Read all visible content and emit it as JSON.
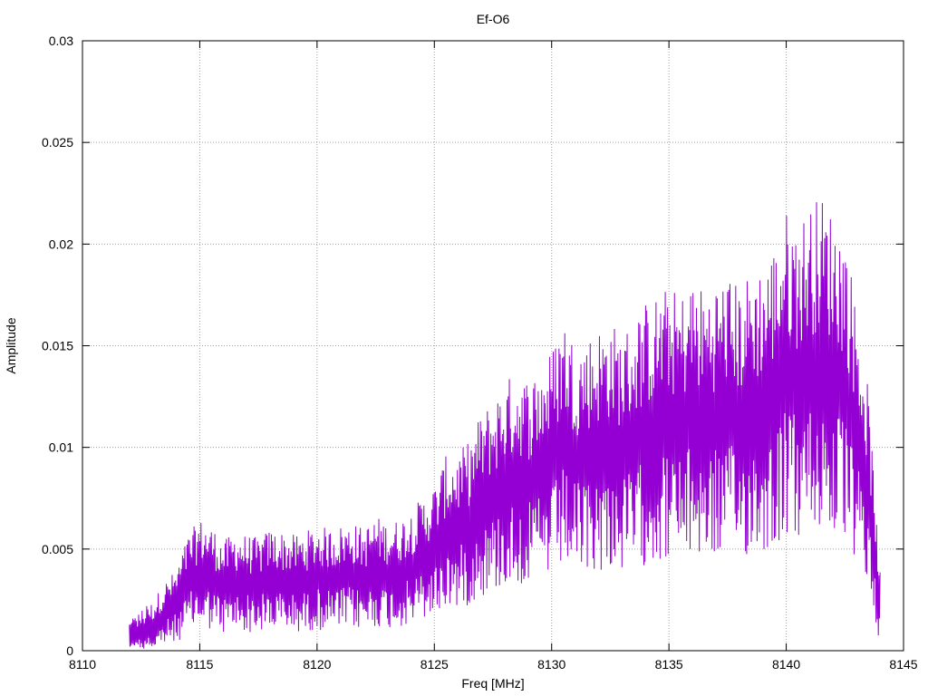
{
  "chart_data": {
    "type": "line",
    "title": "Ef-O6",
    "xlabel": "Freq [MHz]",
    "ylabel": "Amplitude",
    "xlim": [
      8110,
      8145
    ],
    "ylim": [
      0,
      0.03
    ],
    "xticks": [
      8110,
      8115,
      8120,
      8125,
      8130,
      8135,
      8140,
      8145
    ],
    "xtick_labels": [
      "8110",
      "8115",
      "8120",
      "8125",
      "8130",
      "8135",
      "8140",
      "8145"
    ],
    "yticks": [
      0,
      0.005,
      0.01,
      0.015,
      0.02,
      0.025,
      0.03
    ],
    "ytick_labels": [
      "0",
      "0.005",
      "0.01",
      "0.015",
      "0.02",
      "0.025",
      "0.03"
    ],
    "grid": true,
    "line_color": "#9400d3",
    "series": [
      {
        "name": "",
        "x": [
          8112.0,
          8112.5,
          8113.0,
          8113.5,
          8114.0,
          8114.5,
          8115.0,
          8115.5,
          8116.0,
          8116.5,
          8117.0,
          8117.5,
          8118.0,
          8118.5,
          8119.0,
          8119.5,
          8120.0,
          8120.5,
          8121.0,
          8121.5,
          8122.0,
          8122.5,
          8123.0,
          8123.5,
          8124.0,
          8124.5,
          8125.0,
          8125.5,
          8126.0,
          8126.5,
          8127.0,
          8127.5,
          8128.0,
          8128.5,
          8129.0,
          8129.5,
          8130.0,
          8130.5,
          8131.0,
          8131.5,
          8132.0,
          8132.5,
          8133.0,
          8133.5,
          8134.0,
          8134.5,
          8135.0,
          8135.5,
          8136.0,
          8136.5,
          8137.0,
          8137.5,
          8138.0,
          8138.5,
          8139.0,
          8139.5,
          8140.0,
          8140.5,
          8141.0,
          8141.5,
          8142.0,
          8142.5,
          8143.0,
          8143.5,
          8144.0
        ],
        "y": [
          0.0006,
          0.0009,
          0.0012,
          0.0018,
          0.0022,
          0.0033,
          0.0038,
          0.0036,
          0.0031,
          0.0034,
          0.0033,
          0.0032,
          0.0035,
          0.0034,
          0.0033,
          0.0034,
          0.0036,
          0.0035,
          0.0036,
          0.0037,
          0.0035,
          0.0039,
          0.0037,
          0.0038,
          0.0041,
          0.0045,
          0.0049,
          0.0058,
          0.0059,
          0.0063,
          0.0072,
          0.0076,
          0.0082,
          0.0085,
          0.0083,
          0.0087,
          0.0092,
          0.0103,
          0.0094,
          0.0096,
          0.0099,
          0.0101,
          0.0097,
          0.0102,
          0.0107,
          0.0109,
          0.0112,
          0.0109,
          0.0115,
          0.0111,
          0.0114,
          0.0116,
          0.0112,
          0.0117,
          0.0119,
          0.0125,
          0.0136,
          0.0132,
          0.0138,
          0.0141,
          0.0135,
          0.0129,
          0.0106,
          0.0079,
          0.0021
        ]
      }
    ]
  }
}
